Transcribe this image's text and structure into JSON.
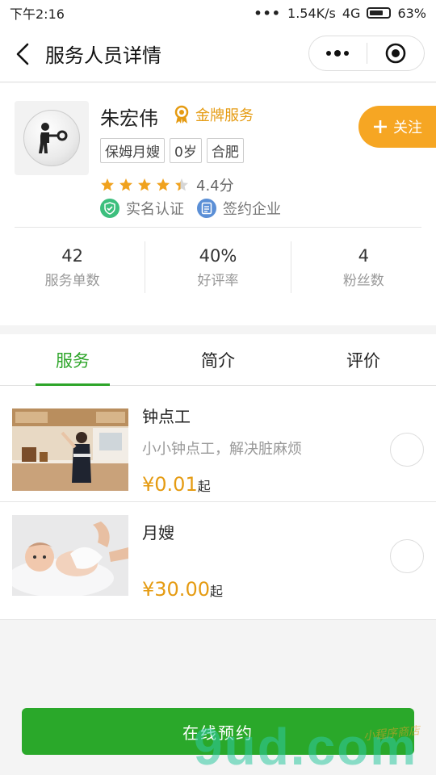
{
  "status_bar": {
    "time": "下午2:16",
    "dots": "•••",
    "speed": "1.54K/s",
    "network": "4G",
    "battery": "63%"
  },
  "nav": {
    "title": "服务人员详情"
  },
  "profile": {
    "name": "朱宏伟",
    "badge": "金牌服务",
    "follow_label": "关注",
    "tags": [
      "保姆月嫂",
      "0岁",
      "合肥"
    ],
    "rating_value": 4.4,
    "rating_text": "4.4分",
    "certs": [
      {
        "label": "实名认证",
        "icon": "shield-check-icon",
        "color": "#3cbf7d"
      },
      {
        "label": "签约企业",
        "icon": "document-icon",
        "color": "#5b8fd6"
      }
    ],
    "stats": [
      {
        "value": "42",
        "label": "服务单数"
      },
      {
        "value": "40%",
        "label": "好评率"
      },
      {
        "value": "4",
        "label": "粉丝数"
      }
    ]
  },
  "tabs": [
    {
      "label": "服务",
      "active": true
    },
    {
      "label": "简介",
      "active": false
    },
    {
      "label": "评价",
      "active": false
    }
  ],
  "services": [
    {
      "title": "钟点工",
      "desc": "小小钟点工，解决脏麻烦",
      "price": "¥0.01",
      "unit": "起"
    },
    {
      "title": "月嫂",
      "desc": "",
      "price": "¥30.00",
      "unit": "起"
    }
  ],
  "bottom": {
    "book_label": "在线预约"
  },
  "watermark": {
    "main": "9ud.com",
    "small": "小程序商店"
  },
  "colors": {
    "accent_green": "#2ea52a",
    "gold": "#e59b12",
    "follow_orange": "#f6a623"
  }
}
